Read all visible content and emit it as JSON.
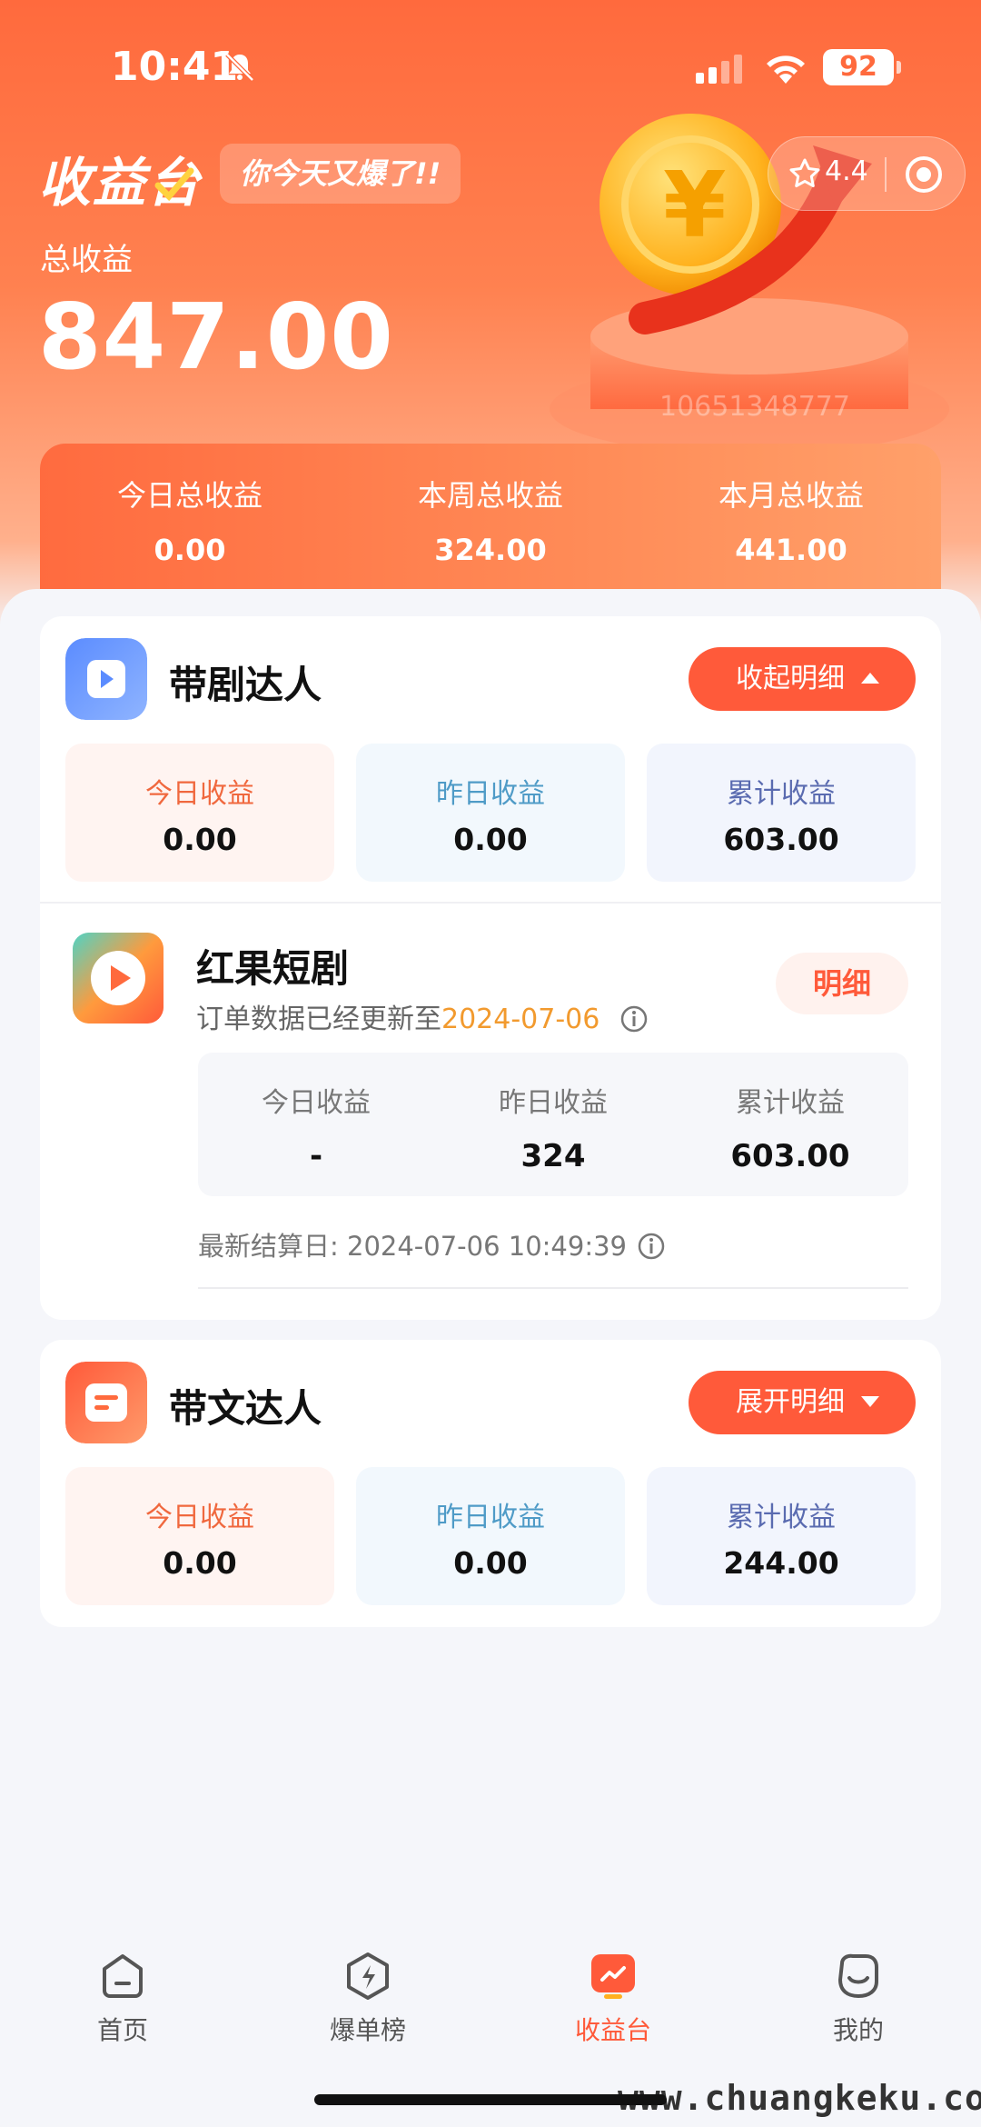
{
  "status_bar": {
    "time": "10:41",
    "battery": "92"
  },
  "header": {
    "app_title": "收益台",
    "slogan": "你今天又爆了!!",
    "rating": "4.4",
    "watermark_id": "10651348777"
  },
  "total": {
    "label": "总收益",
    "value": "847.00"
  },
  "summary": [
    {
      "label": "今日总收益",
      "value": "0.00"
    },
    {
      "label": "本周总收益",
      "value": "324.00"
    },
    {
      "label": "本月总收益",
      "value": "441.00"
    }
  ],
  "section_drama": {
    "title": "带剧达人",
    "toggle_label": "收起明细",
    "boxes": [
      {
        "label": "今日收益",
        "value": "0.00"
      },
      {
        "label": "昨日收益",
        "value": "0.00"
      },
      {
        "label": "累计收益",
        "value": "603.00"
      }
    ],
    "app": {
      "name": "红果短剧",
      "update_prefix": "订单数据已经更新至",
      "update_date": "2024-07-06",
      "detail_label": "明细",
      "stats": [
        {
          "label": "今日收益",
          "value": "-"
        },
        {
          "label": "昨日收益",
          "value": "324"
        },
        {
          "label": "累计收益",
          "value": "603.00"
        }
      ],
      "settle_label": "最新结算日:",
      "settle_time": "2024-07-06 10:49:39"
    }
  },
  "section_text": {
    "title": "带文达人",
    "toggle_label": "展开明细",
    "boxes": [
      {
        "label": "今日收益",
        "value": "0.00"
      },
      {
        "label": "昨日收益",
        "value": "0.00"
      },
      {
        "label": "累计收益",
        "value": "244.00"
      }
    ]
  },
  "tabbar": [
    {
      "label": "首页",
      "icon": "home-icon"
    },
    {
      "label": "爆单榜",
      "icon": "lightning-icon"
    },
    {
      "label": "收益台",
      "icon": "earnings-icon",
      "active": true
    },
    {
      "label": "我的",
      "icon": "profile-icon"
    }
  ],
  "watermark_site": "www.chuangkeku.com",
  "colors": {
    "accent": "#ff5a3a",
    "header": "#ff6a3d",
    "highlight_date": "#f29a2e"
  }
}
